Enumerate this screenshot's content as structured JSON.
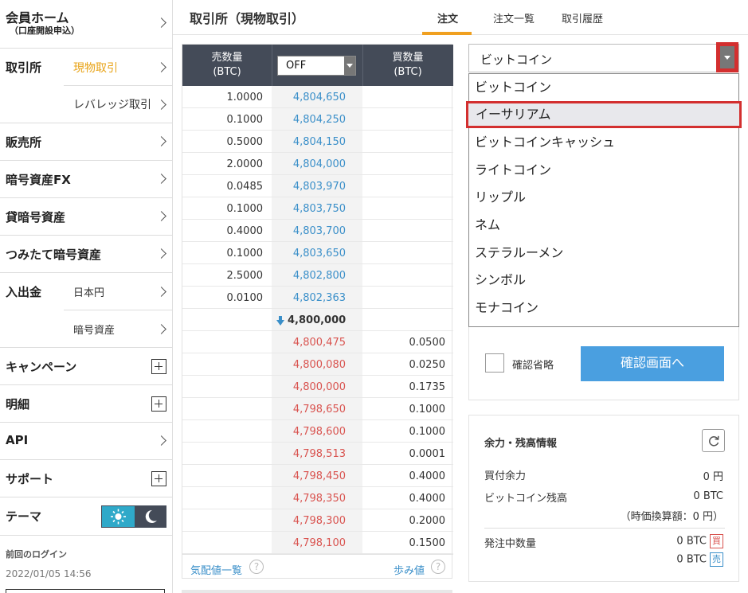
{
  "sidebar": {
    "member_home": "会員ホーム",
    "member_home_sub": "（口座開設申込）",
    "exchange": "取引所",
    "spot": "現物取引",
    "leverage": "レバレッジ取引",
    "sales": "販売所",
    "crypto_fx": "暗号資産FX",
    "lending": "貸暗号資産",
    "tsumitate": "つみたて暗号資産",
    "deposit": "入出金",
    "jpy": "日本円",
    "crypto": "暗号資産",
    "campaign": "キャンペーン",
    "statement": "明細",
    "api": "API",
    "support": "サポート",
    "theme": "テーマ",
    "last_login_label": "前回のログイン",
    "last_login_time": "2022/01/05 14:56"
  },
  "header": {
    "title": "取引所（現物取引）",
    "tabs": [
      "注文",
      "注文一覧",
      "取引履歴"
    ]
  },
  "orderbook": {
    "sell_header": [
      "売数量",
      "(BTC)"
    ],
    "buy_header": [
      "買数量",
      "(BTC)"
    ],
    "select_value": "OFF",
    "asks": [
      {
        "qty": "1.0000",
        "price": "4,804,650"
      },
      {
        "qty": "0.1000",
        "price": "4,804,250"
      },
      {
        "qty": "0.5000",
        "price": "4,804,150"
      },
      {
        "qty": "2.0000",
        "price": "4,804,000"
      },
      {
        "qty": "0.0485",
        "price": "4,803,970"
      },
      {
        "qty": "0.1000",
        "price": "4,803,750"
      },
      {
        "qty": "0.4000",
        "price": "4,803,700"
      },
      {
        "qty": "0.1000",
        "price": "4,803,650"
      },
      {
        "qty": "2.5000",
        "price": "4,802,800"
      },
      {
        "qty": "0.0100",
        "price": "4,802,363"
      }
    ],
    "last_price": "4,800,000",
    "bids": [
      {
        "price": "4,800,475",
        "qty": "0.0500"
      },
      {
        "price": "4,800,080",
        "qty": "0.0250"
      },
      {
        "price": "4,800,000",
        "qty": "0.1735"
      },
      {
        "price": "4,798,650",
        "qty": "0.1000"
      },
      {
        "price": "4,798,600",
        "qty": "0.1000"
      },
      {
        "price": "4,798,513",
        "qty": "0.0001"
      },
      {
        "price": "4,798,450",
        "qty": "0.4000"
      },
      {
        "price": "4,798,350",
        "qty": "0.4000"
      },
      {
        "price": "4,798,300",
        "qty": "0.2000"
      },
      {
        "price": "4,798,100",
        "qty": "0.1500"
      }
    ],
    "footer_left": "気配値一覧",
    "footer_right": "歩み値"
  },
  "order": {
    "selected_coin": "ビットコイン",
    "coins": [
      "ビットコイン",
      "イーサリアム",
      "ビットコインキャッシュ",
      "ライトコイン",
      "リップル",
      "ネム",
      "ステラルーメン",
      "シンボル",
      "モナコイン"
    ],
    "highlighted_index": 1,
    "confirm_skip": "確認省略",
    "confirm_button": "確認画面へ"
  },
  "balance": {
    "title": "余力・残高情報",
    "buy_power_label": "買付余力",
    "buy_power_value": "0 円",
    "btc_balance_label": "ビットコイン残高",
    "btc_balance_value": "0 BTC",
    "btc_jpy_value": "（時価換算額：0 円）",
    "pending_label": "発注中数量",
    "pending_buy": "0 BTC",
    "pending_sell": "0 BTC",
    "buy_badge": "買",
    "sell_badge": "売"
  },
  "colors": {
    "accent": "#f0a020",
    "ask_price": "#3a8fc9",
    "bid_price": "#d9534f",
    "header_dark": "#444b58",
    "confirm_button": "#4a9fe0",
    "highlight_border": "#d32f2f"
  }
}
